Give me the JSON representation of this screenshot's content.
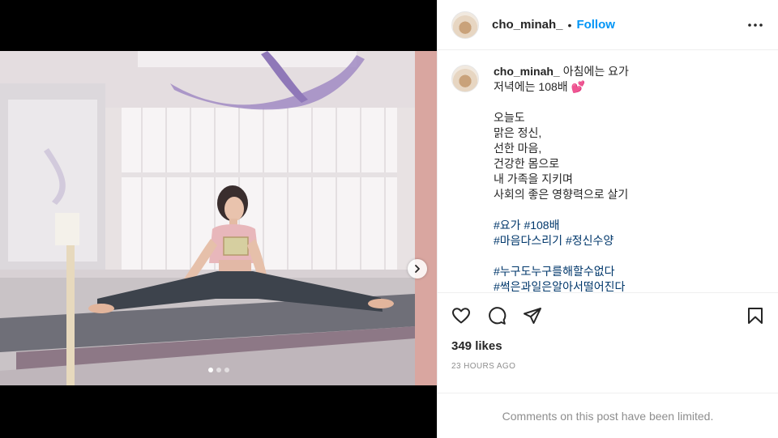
{
  "post": {
    "username": "cho_minah_",
    "separator": "•",
    "follow_label": "Follow",
    "more_icon": "more-horizontal-icon"
  },
  "caption": {
    "username": "cho_minah_",
    "lines": [
      "아침에는 요가",
      "저녁에는 108배 💕",
      "",
      "오늘도",
      "맑은 정신,",
      "선한 마음,",
      "건강한 몸으로",
      "내 가족을 지키며",
      "사회의 좋은 영향력으로 살기",
      ""
    ],
    "hashtags": [
      [
        "#요가",
        "#108배"
      ],
      [
        "#마음다스리기",
        "#정신수양"
      ],
      [],
      [
        "#누구도누구를해할수없다"
      ],
      [
        "#썩은과일은알아서떨어진다"
      ]
    ]
  },
  "carousel": {
    "count": 3,
    "active_index": 0,
    "next_icon": "chevron-right-icon"
  },
  "actions": {
    "like_icon": "heart-icon",
    "comment_icon": "comment-icon",
    "share_icon": "paper-plane-icon",
    "save_icon": "bookmark-icon"
  },
  "likes_text": "349 likes",
  "timestamp": "23 HOURS AGO",
  "comments_limited": "Comments on this post have been limited.",
  "colors": {
    "follow": "#0095f6",
    "hashtag": "#00376b",
    "muted": "#8e8e8e",
    "text": "#262626"
  }
}
